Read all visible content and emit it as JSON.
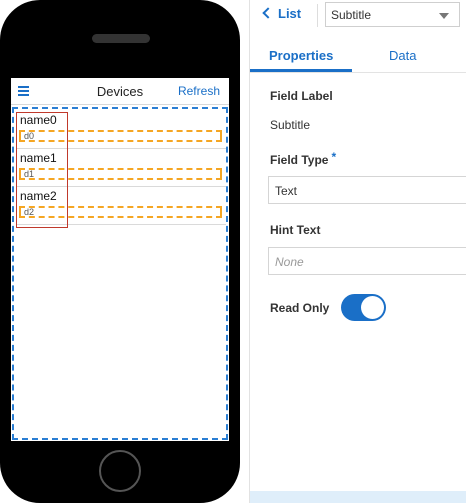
{
  "phone_app": {
    "title": "Devices",
    "refresh_label": "Refresh",
    "rows": [
      {
        "name": "name0",
        "subtitle": "d0"
      },
      {
        "name": "name1",
        "subtitle": "d1"
      },
      {
        "name": "name2",
        "subtitle": "d2"
      }
    ]
  },
  "panel": {
    "back_label": "List",
    "component_select": "Subtitle",
    "tabs": [
      "Properties",
      "Data"
    ],
    "field_label_heading": "Field Label",
    "field_label_value": "Subtitle",
    "field_type_heading": "Field Type",
    "field_type_required_mark": "*",
    "field_type_value": "Text",
    "hint_text_heading": "Hint Text",
    "hint_text_placeholder": "None",
    "read_only_heading": "Read Only",
    "read_only_on": true
  },
  "colors": {
    "accent": "#1a6fc7",
    "selection": "#c0392b",
    "subtitle_outline": "#f5a623"
  }
}
